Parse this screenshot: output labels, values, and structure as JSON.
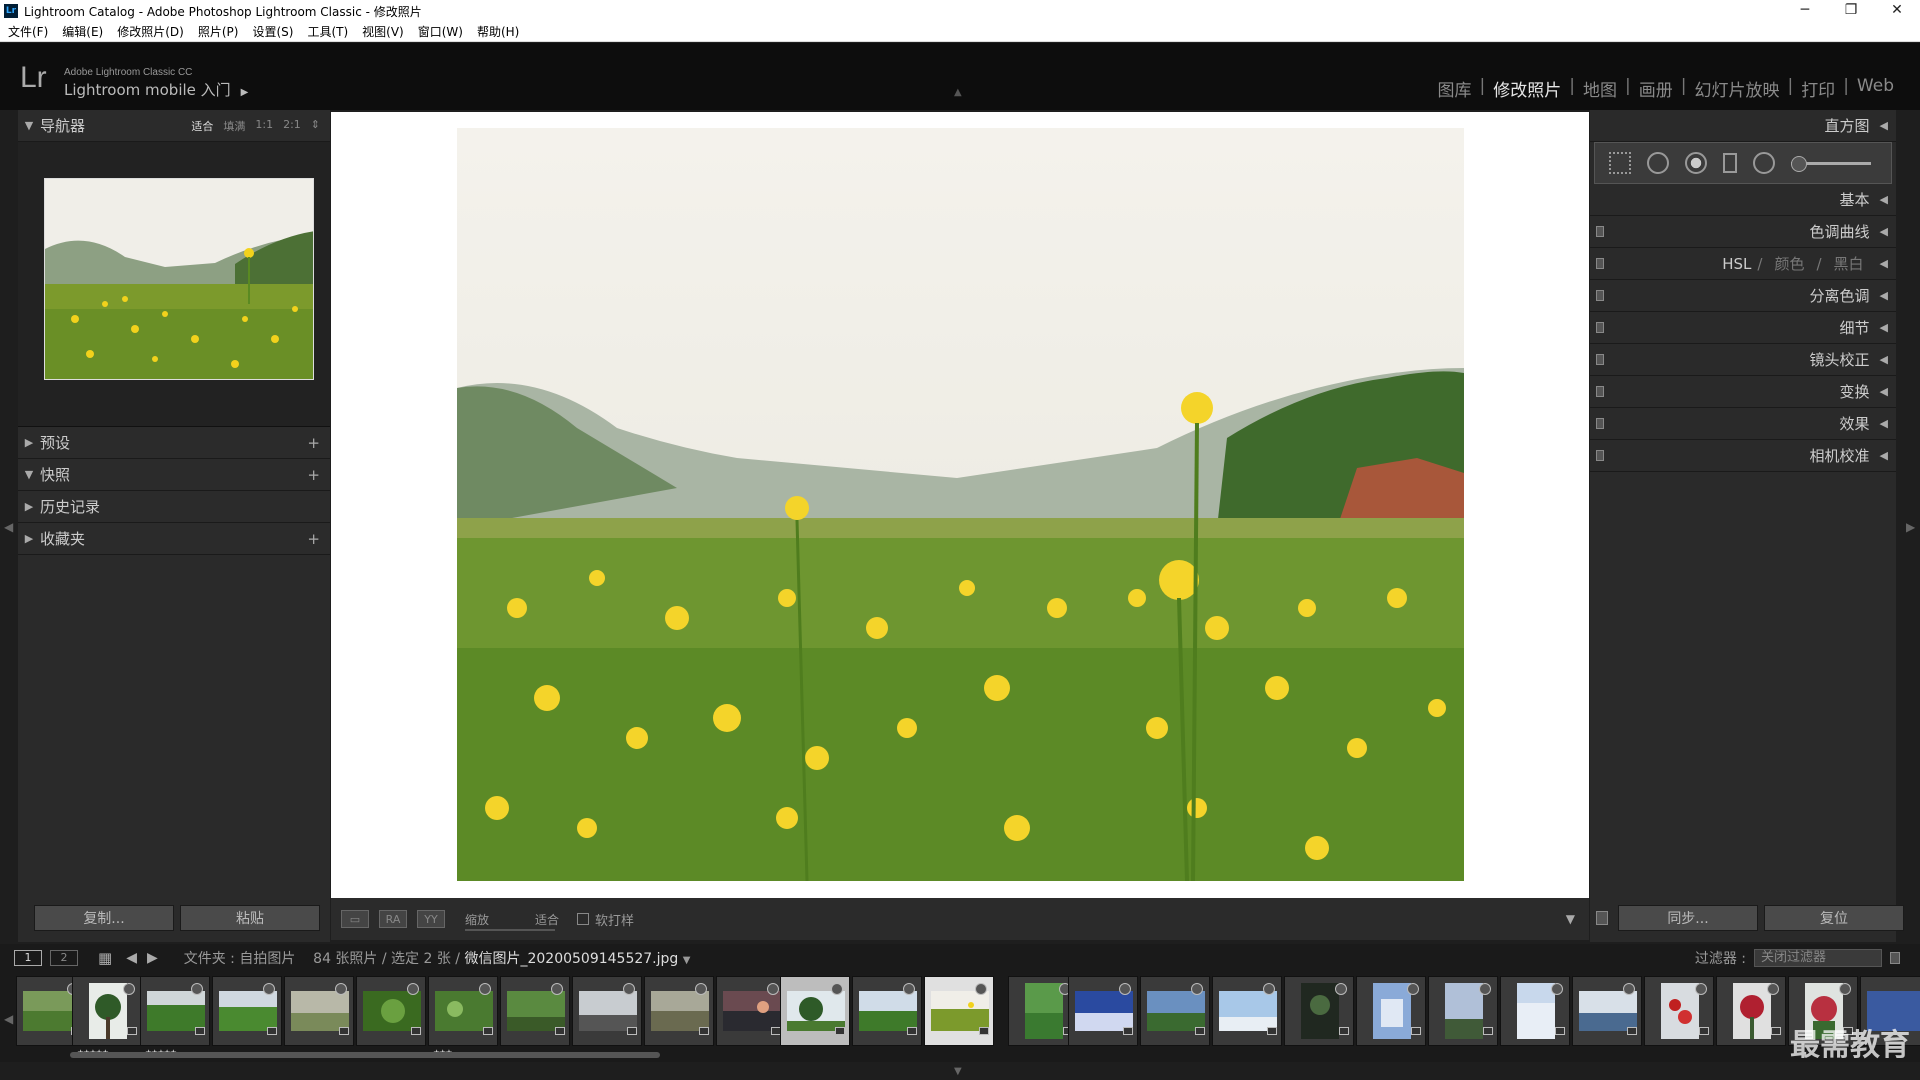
{
  "window": {
    "title": "Lightroom Catalog - Adobe Photoshop Lightroom Classic - 修改照片",
    "app_icon": "Lr",
    "controls": [
      "─",
      "❐",
      "✕"
    ]
  },
  "menu": [
    "文件(F)",
    "编辑(E)",
    "修改照片(D)",
    "照片(P)",
    "设置(S)",
    "工具(T)",
    "视图(V)",
    "窗口(W)",
    "帮助(H)"
  ],
  "identity": {
    "logo": "Lr",
    "product": "Adobe Lightroom Classic CC",
    "mobile": "Lightroom mobile 入门"
  },
  "modules": {
    "items": [
      "图库",
      "修改照片",
      "地图",
      "画册",
      "幻灯片放映",
      "打印",
      "Web"
    ],
    "separator": "|",
    "active": "修改照片"
  },
  "left_panel": {
    "navigator": {
      "title": "导航器",
      "zoom": [
        "适合",
        "填满",
        "1:1",
        "2:1"
      ],
      "zoom_active": "适合"
    },
    "sections": [
      {
        "title": "预设",
        "expanded": false,
        "plus": "+"
      },
      {
        "title": "快照",
        "expanded": true,
        "plus": "+"
      },
      {
        "title": "历史记录",
        "expanded": false,
        "plus": ""
      },
      {
        "title": "收藏夹",
        "expanded": false,
        "plus": "+"
      }
    ],
    "copy_button": "复制...",
    "paste_button": "粘贴"
  },
  "right_panel": {
    "histogram": "直方图",
    "basic": "基本",
    "panels": [
      "色调曲线",
      "分离色调",
      "细节",
      "镜头校正",
      "变换",
      "效果",
      "相机校准"
    ],
    "hsl": {
      "a": "HSL",
      "sep": "/",
      "b": "颜色",
      "c": "黑白"
    },
    "sync_button": "同步...",
    "reset_button": "复位"
  },
  "toolbar": {
    "zoom_label": "缩放",
    "zoom_value": "适合",
    "softproof_label": "软打样",
    "compare_ab": "RA",
    "compare_yy": "YY"
  },
  "filmstrip_bar": {
    "monitor1": "1",
    "monitor2": "2",
    "source_prefix": "文件夹 : 自拍图片",
    "counts": "84 张照片 / 选定 2 张 /",
    "filename": "微信图片_20200509145527.jpg",
    "filter_label": "过滤器 :",
    "filter_value": "关闭过滤器"
  },
  "watermark": "最需教育",
  "colors": {
    "accent": "#e6e6e6",
    "panel_bg": "#2a2a2a",
    "identity_bg": "#0d0d0d"
  }
}
